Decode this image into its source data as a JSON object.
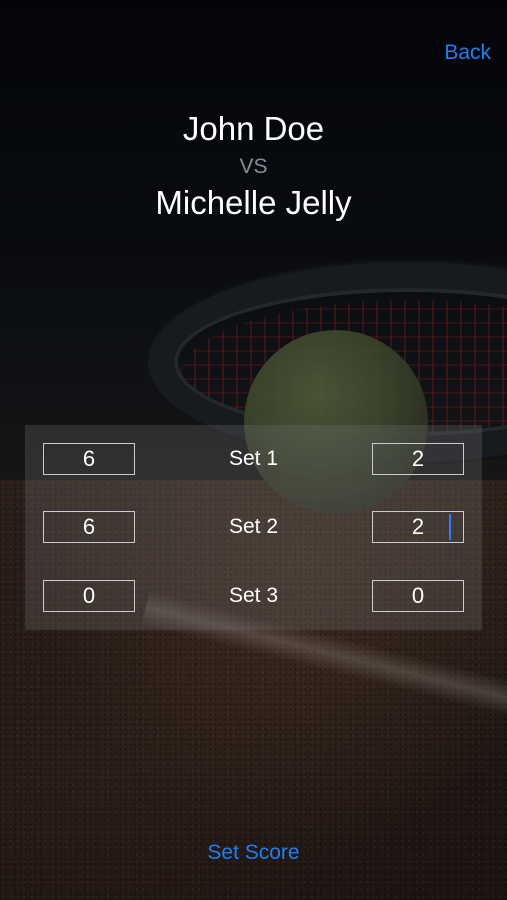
{
  "nav": {
    "back_label": "Back"
  },
  "match": {
    "player_one": "John Doe",
    "vs_label": "VS",
    "player_two": "Michelle Jelly"
  },
  "sets": [
    {
      "label": "Set 1",
      "player_one_score": "6",
      "player_two_score": "2"
    },
    {
      "label": "Set 2",
      "player_one_score": "6",
      "player_two_score": "2"
    },
    {
      "label": "Set 3",
      "player_one_score": "0",
      "player_two_score": "0"
    }
  ],
  "actions": {
    "set_score_label": "Set Score"
  },
  "colors": {
    "accent": "#1e80f0",
    "text": "#ffffff",
    "muted": "#8a8d93"
  }
}
